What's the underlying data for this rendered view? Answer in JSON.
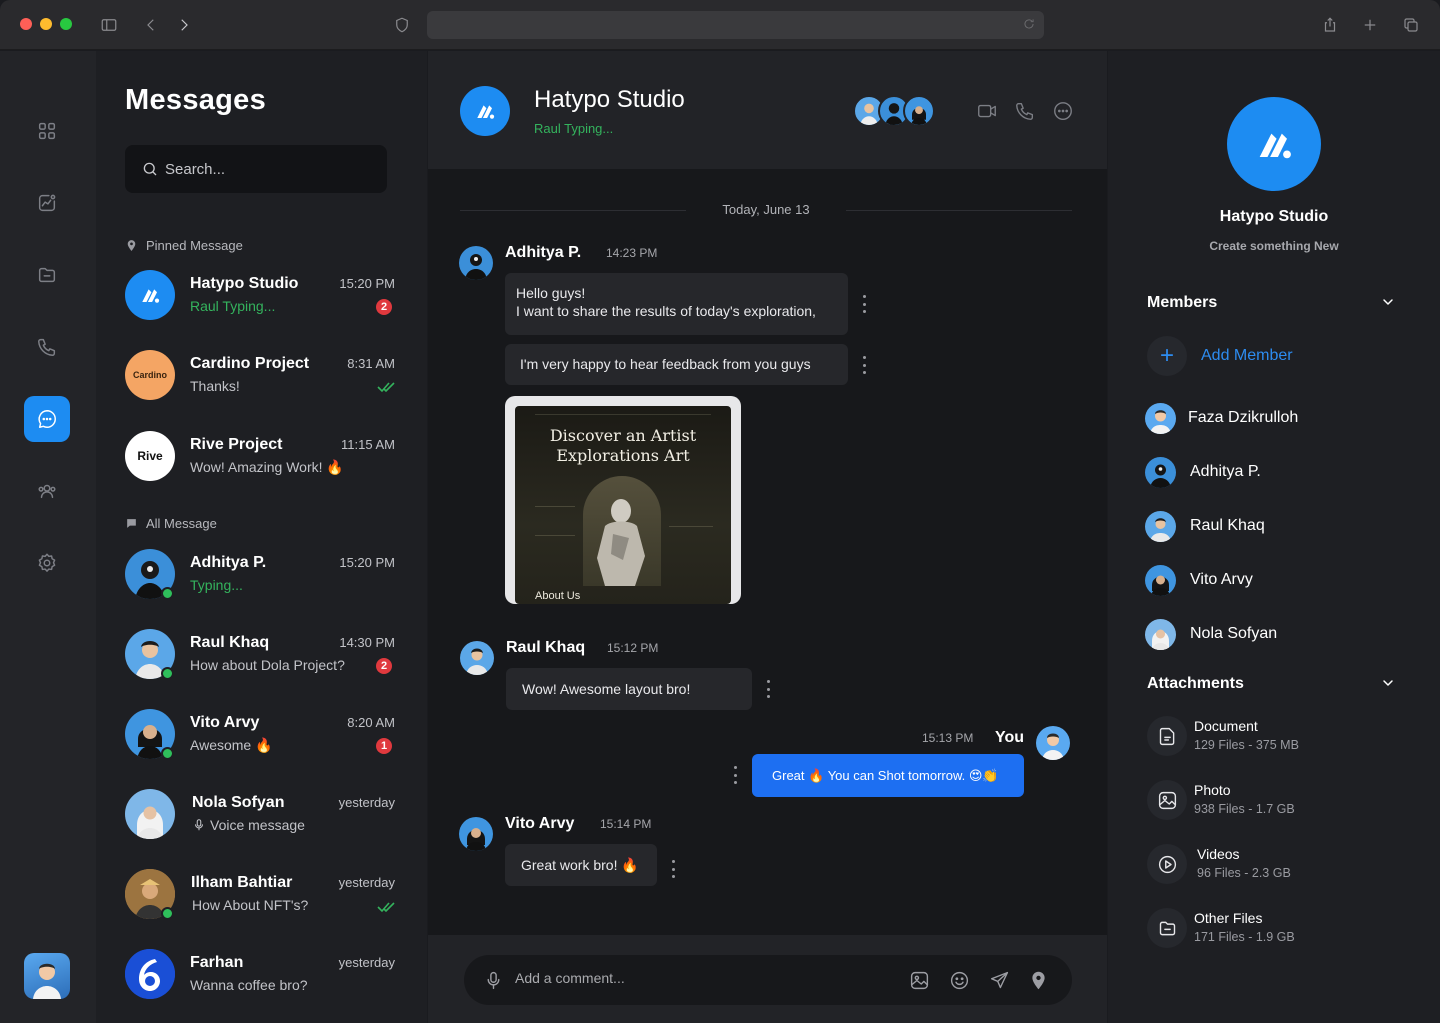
{
  "sidebar_rail": {
    "items": [
      {
        "icon": "grid-icon"
      },
      {
        "icon": "analytics-icon"
      },
      {
        "icon": "folder-icon"
      },
      {
        "icon": "phone-icon"
      },
      {
        "icon": "chat-icon",
        "active": true
      },
      {
        "icon": "users-icon"
      },
      {
        "icon": "settings-icon"
      }
    ]
  },
  "list": {
    "title": "Messages",
    "search_placeholder": "Search...",
    "pinned_label": "Pinned Message",
    "all_label": "All Message",
    "pinned": [
      {
        "name": "Hatypo Studio",
        "preview": "Raul Typing...",
        "time": "15:20 PM",
        "badge": "2",
        "typing": true
      },
      {
        "name": "Cardino Project",
        "preview": "Thanks!",
        "time": "8:31 AM",
        "read": true,
        "avatar_text": "Cardino"
      },
      {
        "name": "Rive Project",
        "preview": "Wow! Amazing Work! 🔥",
        "time": "11:15 AM",
        "avatar_text": "Rive"
      }
    ],
    "all": [
      {
        "name": "Adhitya P.",
        "preview": "Typing...",
        "time": "15:20 PM",
        "typing": true,
        "online": true
      },
      {
        "name": "Raul Khaq",
        "preview": "How about Dola Project?",
        "time": "14:30 PM",
        "badge": "2",
        "online": true
      },
      {
        "name": "Vito Arvy",
        "preview": "Awesome 🔥",
        "time": "8:20 AM",
        "badge": "1",
        "online": true
      },
      {
        "name": "Nola Sofyan",
        "preview": "Voice message",
        "time": "yesterday"
      },
      {
        "name": "Ilham Bahtiar",
        "preview": "How About NFT's?",
        "time": "yesterday",
        "read": true,
        "online": true
      },
      {
        "name": "Farhan",
        "preview": "Wanna coffee bro?",
        "time": "yesterday"
      }
    ]
  },
  "chat": {
    "title": "Hatypo Studio",
    "status": "Raul Typing...",
    "date": "Today, June 13",
    "messages": {
      "m1": {
        "name": "Adhitya P.",
        "time": "14:23 PM",
        "line1": "Hello guys!",
        "line2": "I want to share the results of today's exploration,",
        "text2": "I'm very happy to hear feedback from you guys"
      },
      "m2": {
        "name": "Raul Khaq",
        "time": "15:12 PM",
        "text": "Wow! Awesome layout bro!"
      },
      "m3": {
        "name": "You",
        "time": "15:13 PM",
        "text": "Great 🔥 You can Shot tomorrow. 😍👏"
      },
      "m4": {
        "name": "Vito Arvy",
        "time": "15:14 PM",
        "text": "Great work bro! 🔥"
      }
    },
    "shot": {
      "heading1": "Discover an Artist",
      "heading2": "Explorations Art",
      "footer": "About Us"
    },
    "composer_placeholder": "Add a comment..."
  },
  "info": {
    "title": "Hatypo Studio",
    "subtitle": "Create something New",
    "members_label": "Members",
    "add_member": "Add Member",
    "members": [
      "Faza Dzikrulloh",
      "Adhitya P.",
      "Raul Khaq",
      "Vito Arvy",
      "Nola Sofyan"
    ],
    "attachments_label": "Attachments",
    "attachments": [
      {
        "title": "Document",
        "meta": "129 Files - 375 MB",
        "icon": "document-icon"
      },
      {
        "title": "Photo",
        "meta": "938 Files - 1.7 GB",
        "icon": "photo-icon"
      },
      {
        "title": "Videos",
        "meta": "96 Files - 2.3 GB",
        "icon": "video-icon"
      },
      {
        "title": "Other Files",
        "meta": "171 Files - 1.9 GB",
        "icon": "folder-icon"
      }
    ]
  },
  "colors": {
    "accent": "#1d8cf2",
    "online": "#2fbf5b",
    "badge": "#e0393e",
    "bg": "#17181b"
  }
}
